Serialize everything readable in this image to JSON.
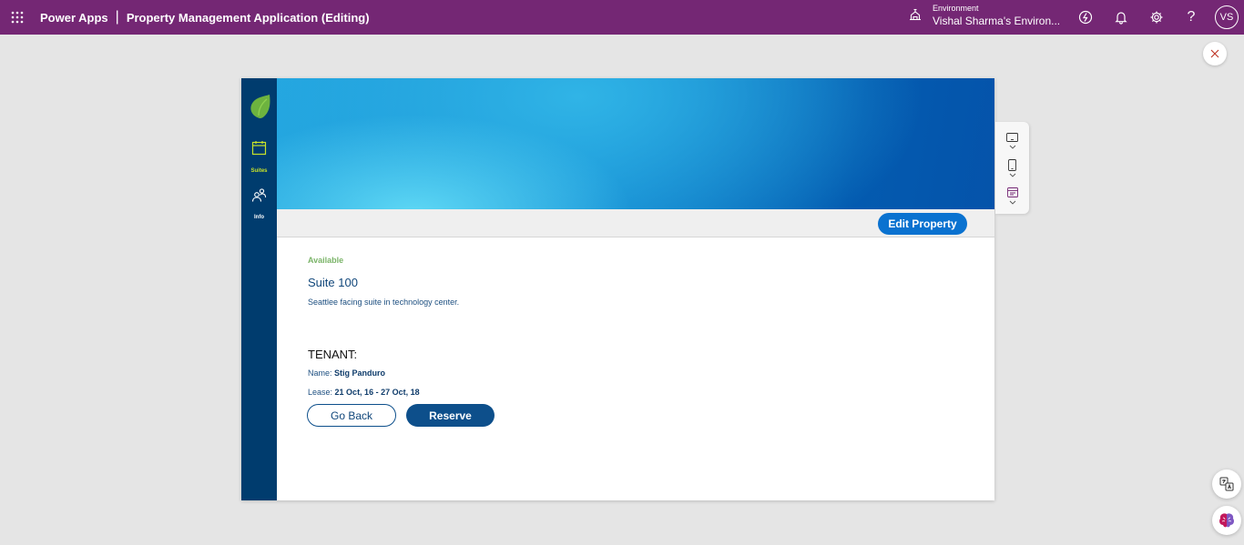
{
  "topbar": {
    "brand": "Power Apps",
    "separator": "|",
    "app_title": "Property Management Application (Editing)",
    "environment_label": "Environment",
    "environment_value": "Vishal Sharma's Environ...",
    "avatar_initials": "VS",
    "icons": [
      "waffle-icon",
      "environment-icon",
      "copilot-icon",
      "notification-bell-icon",
      "settings-gear-icon",
      "help-icon"
    ]
  },
  "app": {
    "nav": [
      {
        "label": "Suites",
        "icon": "calendar-icon",
        "active": true
      },
      {
        "label": "Info",
        "icon": "people-icon",
        "active": false
      }
    ],
    "edit_button": "Edit Property",
    "status": "Available",
    "suite_name": "Suite 100",
    "suite_description": "Seattlee facing suite in technology center.",
    "tenant_heading": "TENANT:",
    "name_label": "Name:",
    "name_value": "Stig Panduro",
    "lease_label": "Lease:",
    "lease_value": "21 Oct, 16 - 27 Oct, 18",
    "go_back": "Go Back",
    "reserve": "Reserve"
  },
  "colors": {
    "topbar": "#742774",
    "sidenav": "#003c6e",
    "accent_green": "#c8e32a",
    "primary_button": "#0a72d0",
    "dark_button": "#0d4f8b",
    "status_green": "#7bb469"
  }
}
